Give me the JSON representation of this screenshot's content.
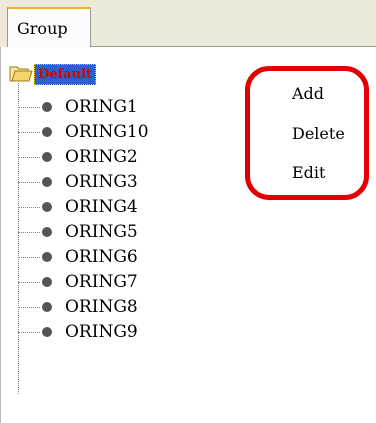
{
  "tab": {
    "label": "Group"
  },
  "tree": {
    "root": {
      "label": "Default",
      "icon": "folder-open-icon"
    },
    "items": [
      {
        "label": "ORING1"
      },
      {
        "label": "ORING10"
      },
      {
        "label": "ORING2"
      },
      {
        "label": "ORING3"
      },
      {
        "label": "ORING4"
      },
      {
        "label": "ORING5"
      },
      {
        "label": "ORING6"
      },
      {
        "label": "ORING7"
      },
      {
        "label": "ORING8"
      },
      {
        "label": "ORING9"
      }
    ]
  },
  "context_menu": {
    "items": [
      {
        "label": "Add"
      },
      {
        "label": "Delete"
      },
      {
        "label": "Edit"
      }
    ]
  },
  "colors": {
    "tab_accent": "#f5b026",
    "selection_bg": "#2e5fd0",
    "selection_text": "#d90000",
    "highlight_ring": "#e20000"
  }
}
